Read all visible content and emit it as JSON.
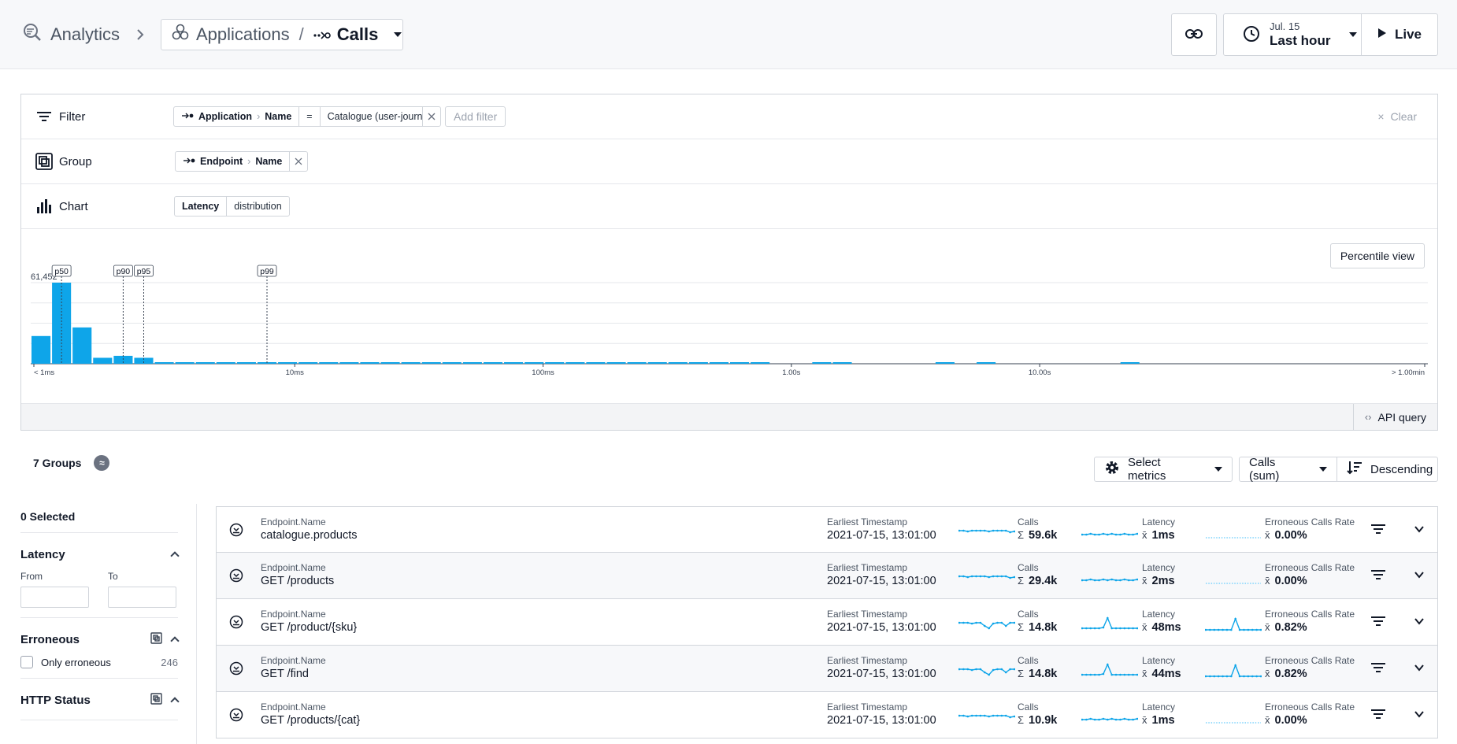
{
  "header": {
    "analytics_label": "Analytics",
    "breadcrumb_sep": ">",
    "applications_label": "Applications",
    "slash": "/",
    "calls_label": "Calls",
    "time_date": "Jul. 15",
    "time_range": "Last hour",
    "live_label": "Live"
  },
  "filter": {
    "label": "Filter",
    "chip": {
      "entity": "Application",
      "field": "Name",
      "op": "=",
      "value": "Catalogue (user-journ"
    },
    "add_label": "Add filter",
    "clear_label": "Clear"
  },
  "group": {
    "label": "Group",
    "chip": {
      "entity": "Endpoint",
      "field": "Name"
    }
  },
  "chart_row": {
    "label": "Chart",
    "metric": "Latency",
    "mode": "distribution"
  },
  "chart_data": {
    "type": "bar",
    "title": "",
    "xlabel": "",
    "ylabel": "",
    "x_scale": "log",
    "max_label": "61,452",
    "ylim": [
      0,
      61452
    ],
    "x_ticks": [
      "< 1ms",
      "10ms",
      "100ms",
      "1.00s",
      "10.00s",
      "> 1.00min"
    ],
    "values": [
      21000,
      61452,
      27500,
      4500,
      6000,
      4500,
      300,
      300,
      300,
      300,
      300,
      300,
      300,
      300,
      300,
      300,
      300,
      300,
      300,
      300,
      300,
      300,
      300,
      300,
      300,
      300,
      300,
      300,
      300,
      300,
      300,
      300,
      300,
      300,
      300,
      300,
      0,
      0,
      300,
      300,
      0,
      0,
      0,
      0,
      300,
      0,
      300,
      0,
      0,
      0,
      0,
      0,
      0,
      300,
      0,
      0,
      0,
      0,
      0,
      0,
      0,
      0,
      0,
      0,
      0,
      0,
      0,
      0
    ],
    "percentiles": [
      {
        "label": "p50",
        "bin": 1
      },
      {
        "label": "p90",
        "bin": 4
      },
      {
        "label": "p95",
        "bin": 5
      },
      {
        "label": "p99",
        "bin": 11
      }
    ],
    "grid": true
  },
  "chart_ui": {
    "percentile_view": "Percentile view",
    "api_query": "API query"
  },
  "groups": {
    "title": "7 Groups",
    "badge": "≈",
    "select_metrics": "Select metrics",
    "sort_by": "Calls (sum)",
    "order": "Descending"
  },
  "sidebar": {
    "selected": "0 Selected",
    "latency": {
      "title": "Latency",
      "from": "From",
      "to": "To"
    },
    "erroneous": {
      "title": "Erroneous",
      "option": "Only erroneous",
      "count": "246"
    },
    "http_status": {
      "title": "HTTP Status"
    }
  },
  "table": {
    "labels": {
      "name": "Endpoint.Name",
      "ts": "Earliest Timestamp",
      "calls": "Calls",
      "latency": "Latency",
      "err": "Erroneous Calls Rate"
    },
    "rows": [
      {
        "name": "catalogue.products",
        "ts": "2021-07-15, 13:01:00",
        "calls": "59.6k",
        "latency": "1ms",
        "err": "0.00%"
      },
      {
        "name": "GET /products",
        "ts": "2021-07-15, 13:01:00",
        "calls": "29.4k",
        "latency": "2ms",
        "err": "0.00%"
      },
      {
        "name": "GET /product/{sku}",
        "ts": "2021-07-15, 13:01:00",
        "calls": "14.8k",
        "latency": "48ms",
        "err": "0.82%"
      },
      {
        "name": "GET /find",
        "ts": "2021-07-15, 13:01:00",
        "calls": "14.8k",
        "latency": "44ms",
        "err": "0.82%"
      },
      {
        "name": "GET /products/{cat}",
        "ts": "2021-07-15, 13:01:00",
        "calls": "10.9k",
        "latency": "1ms",
        "err": "0.00%"
      }
    ],
    "sum_symbol": "Σ",
    "mean_symbol": "x̄",
    "accent": "#0ea5e9"
  }
}
